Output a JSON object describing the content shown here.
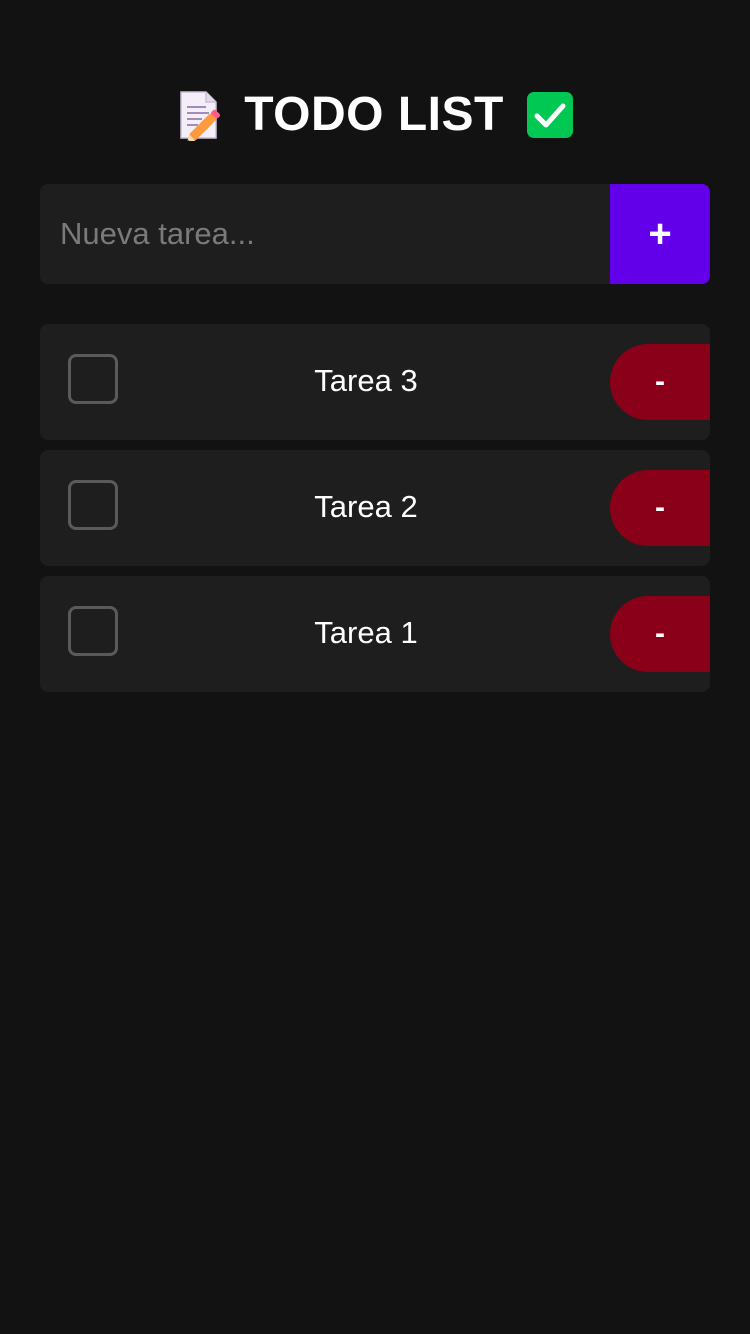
{
  "header": {
    "title": "TODO LIST",
    "left_icon": "memo-icon",
    "right_icon": "check-mark-button-icon"
  },
  "composer": {
    "placeholder": "Nueva tarea...",
    "value": "",
    "add_label": "+"
  },
  "tasks": [
    {
      "label": "Tarea 3",
      "done": false,
      "remove_label": "-"
    },
    {
      "label": "Tarea 2",
      "done": false,
      "remove_label": "-"
    },
    {
      "label": "Tarea 1",
      "done": false,
      "remove_label": "-"
    }
  ],
  "colors": {
    "background": "#121212",
    "surface": "#1e1e1e",
    "accent": "#6200ea",
    "danger": "#8b0019",
    "check_green": "#00c853"
  }
}
